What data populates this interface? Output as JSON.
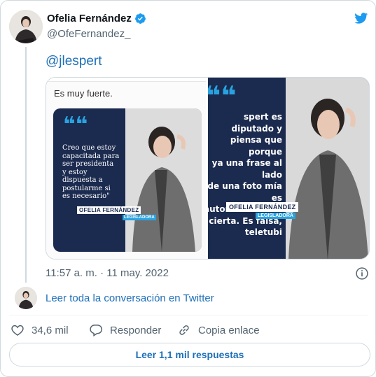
{
  "author": {
    "name": "Ofelia Fernández",
    "handle": "@OfeFernandez_",
    "verified": true
  },
  "tweet": {
    "text": "@jlespert",
    "timestamp": "11:57 a. m. · 11 may. 2022"
  },
  "media": {
    "left_image": {
      "caption": "Es muy fuerte.",
      "quote_lines": [
        "Creo que estoy",
        "capacitada para",
        "ser presidenta",
        "y estoy",
        "dispuesta a",
        "postularme si",
        "es necesario\""
      ],
      "tag_name": "OFELIA FERNÁNDEZ",
      "tag_role": "LEGISLADORA"
    },
    "right_image": {
      "text_lines": [
        "spert es diputado y",
        "piensa que porque",
        "ya una frase al lado",
        "de una foto mía es",
        "automáticamente",
        "cierta. Es falsa,",
        "teletubi"
      ],
      "tag_name": "OFELIA FERNÁNDEZ",
      "tag_role": "LEGISLADORA"
    }
  },
  "conversation": {
    "label": "Leer toda la conversación en Twitter"
  },
  "actions": {
    "likes": "34,6 mil",
    "reply_label": "Responder",
    "copy_label": "Copia enlace"
  },
  "replies_button": {
    "label": "Leer 1,1 mil respuestas"
  },
  "icons": {
    "twitter_logo": "twitter-bird-icon",
    "verified": "verified-badge-icon",
    "info": "info-icon",
    "like": "heart-icon",
    "reply": "reply-bubble-icon",
    "copy": "link-icon"
  },
  "colors": {
    "link_blue": "#1d6fb8",
    "twitter_blue": "#1d9bf0",
    "secondary_text": "#536471",
    "border": "#cfd9de",
    "poster_navy": "#1b2a4f",
    "poster_accent": "#29a3e0"
  }
}
